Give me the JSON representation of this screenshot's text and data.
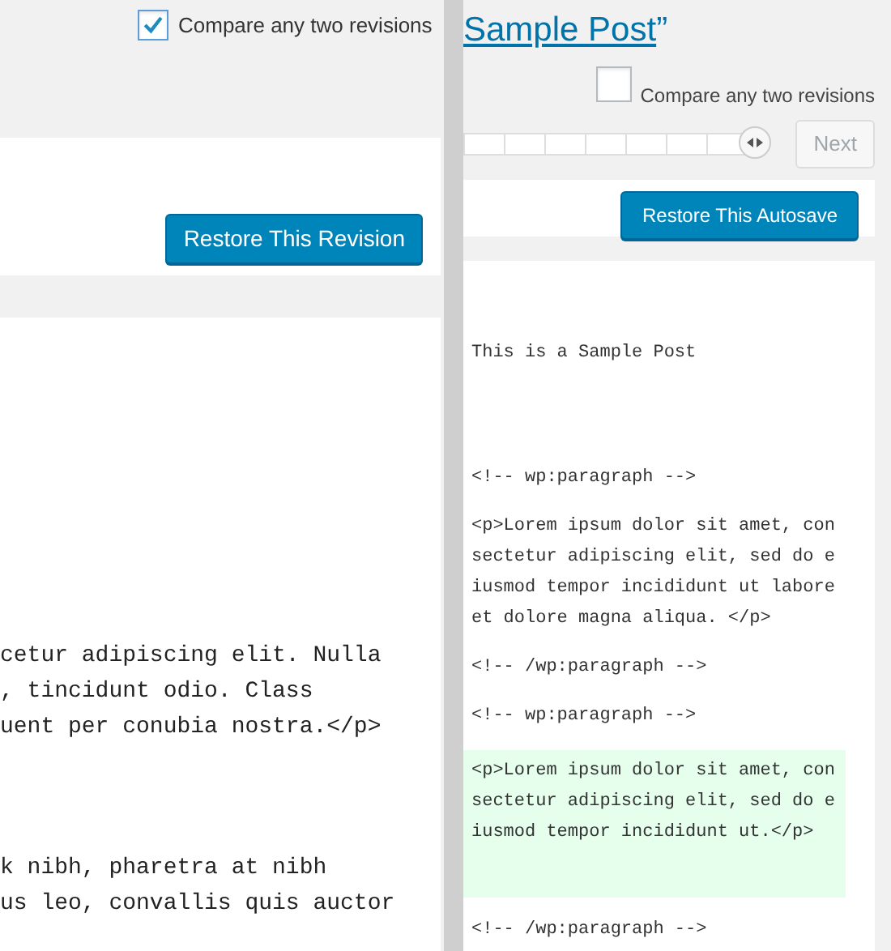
{
  "left_panel": {
    "compare_checkbox": {
      "label": "Compare any two revisions",
      "checked": true
    },
    "restore_button": "Restore This Revision",
    "paragraphs": [
      [
        "cetur adipiscing elit. Nulla",
        ", tincidunt odio. Class",
        "uent per conubia nostra.</p>"
      ],
      [
        "k nibh, pharetra at nibh",
        "us leo, convallis quis auctor"
      ]
    ]
  },
  "right_panel": {
    "title_link": "Sample Post",
    "title_quote": "”",
    "compare_checkbox": {
      "label": "Compare any two revisions",
      "checked": false
    },
    "slider": {
      "level": 1
    },
    "next_button": {
      "label": "Next",
      "disabled": true
    },
    "restore_button": "Restore This Autosave",
    "blocks": [
      {
        "kind": "text",
        "text": "This is a Sample Post"
      },
      {
        "kind": "comment",
        "text": "<!-- wp:paragraph -->"
      },
      {
        "kind": "text",
        "text": "<p>Lorem ipsum dolor sit amet, consectetur adipiscing elit, sed do eiusmod tempor incididunt ut labore et dolore magna aliqua. </p>"
      },
      {
        "kind": "comment",
        "text": "<!-- /wp:paragraph -->"
      },
      {
        "kind": "comment",
        "text": "<!-- wp:paragraph -->"
      },
      {
        "kind": "added",
        "text": "<p>Lorem ipsum dolor sit amet, consectetur adipiscing elit, sed do eiusmod tempor incididunt ut.</p>"
      },
      {
        "kind": "comment",
        "text": "<!-- /wp:paragraph -->"
      }
    ]
  }
}
